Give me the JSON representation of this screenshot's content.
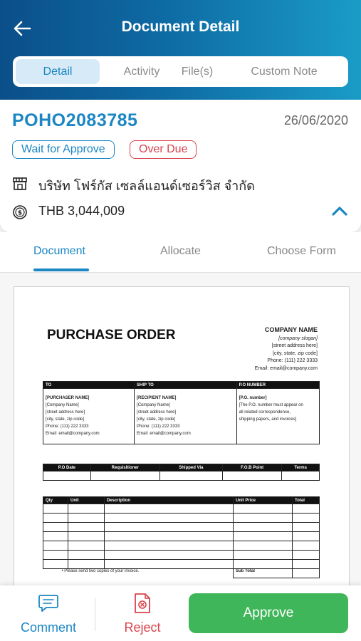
{
  "header": {
    "title": "Document Detail"
  },
  "tabs": [
    {
      "label": "Detail",
      "active": true
    },
    {
      "label": "Activity",
      "active": false
    },
    {
      "label": "File(s)",
      "active": false
    },
    {
      "label": "Custom Note",
      "active": false
    }
  ],
  "document": {
    "number": "POHO2083785",
    "date": "26/06/2020",
    "badges": [
      "Wait for Approve",
      "Over Due"
    ],
    "company": "บริษัท โฟร์กัส เซลล์แอนด์เซอร์วิส จำกัด",
    "amount": "THB 3,044,009"
  },
  "subtabs": [
    {
      "label": "Document",
      "active": true
    },
    {
      "label": "Allocate",
      "active": false
    },
    {
      "label": "Choose Form",
      "active": false
    }
  ],
  "preview": {
    "title": "PURCHASE ORDER",
    "company_name": "COMPANY NAME",
    "slogan": "[company slogan]",
    "address1": "[street address here]",
    "address2": "[city, state, zip code]",
    "phone": "Phone: (111) 222 3333",
    "email": "Email: email@company.com",
    "col_to": "TO",
    "col_ship": "SHIP TO",
    "col_po": "P.O NUMBER",
    "to_lines": [
      "[PURCHASER NAME]",
      "[Company Name]",
      "[street address here]",
      "[city, state, zip code]",
      "Phone: (111) 222 3333",
      "Email: email@company.com"
    ],
    "ship_lines": [
      "[RECIPIENT NAME]",
      "[Company Name]",
      "[street address here]",
      "[city, state, zip code]",
      "Phone: (111) 222 3333",
      "Email: email@company.com"
    ],
    "po_lines": [
      "[P.O. number]",
      "[The P.O. number must appear on",
      "all related correspondence,",
      "shipping papers, and invoices]"
    ],
    "info_headers": [
      "P.O Date",
      "Requisitioner",
      "Shipped Via",
      "F.O.B Point",
      "Terms"
    ],
    "item_headers": [
      "Qty",
      "Unit",
      "Description",
      "Unit Price",
      "Total"
    ],
    "subtotal": "Sub Total",
    "note": "Please send two copies of your invoice."
  },
  "actions": {
    "comment": "Comment",
    "reject": "Reject",
    "approve": "Approve"
  },
  "colors": {
    "primary": "#1b86c4",
    "danger": "#d9434b",
    "success": "#3fb659"
  }
}
